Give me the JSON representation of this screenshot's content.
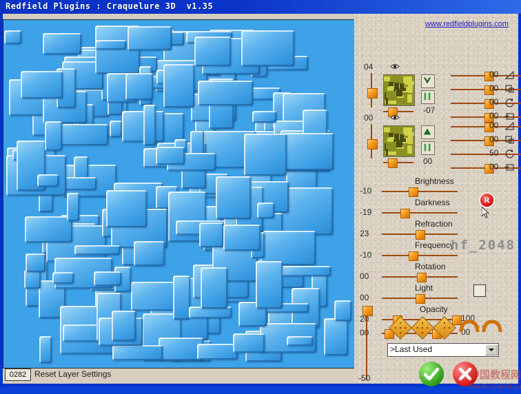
{
  "window": {
    "title": "Redfield Plugins : Craquelure 3D  v1.35"
  },
  "panel": {
    "url": "www.redfieldplugins.com",
    "watermark": "hf_2048",
    "registered_badge": "R",
    "watermark_cn": "中国教程网",
    "watermark_cn_url": "www.jcwcn.com"
  },
  "layers": [
    {
      "name": "layer-1",
      "vertical_value": "04",
      "eye_icon": "eye-icon",
      "thumbnail": "layer-thumbnail",
      "shape_icon": "valley-shape-icon",
      "bars_icon": "bars-shape-icon",
      "offset_value": "-07",
      "sliders": [
        {
          "value": "00",
          "icon": "bevel-wedge-icon",
          "thumb_pct": 50
        },
        {
          "value": "00",
          "icon": "offset-square-icon",
          "thumb_pct": 50
        },
        {
          "value": "00",
          "icon": "rotate-icon",
          "thumb_pct": 50
        },
        {
          "value": "00",
          "icon": "shift-shape-icon",
          "thumb_pct": 50
        }
      ]
    },
    {
      "name": "layer-2",
      "vertical_value": "00",
      "eye_icon": "eye-icon",
      "thumbnail": "layer-thumbnail",
      "shape_icon": "peak-shape-icon",
      "bars_icon": "bars-shape-icon",
      "offset_value": "00",
      "sliders": [
        {
          "value": "00",
          "icon": "bevel-wedge-icon",
          "thumb_pct": 50
        },
        {
          "value": "00",
          "icon": "offset-square-icon",
          "thumb_pct": 50
        },
        {
          "value": "50",
          "icon": "rotate-icon",
          "thumb_pct": 98
        },
        {
          "value": "00",
          "icon": "shift-shape-icon",
          "thumb_pct": 50
        }
      ]
    }
  ],
  "main_sliders": [
    {
      "label": "Brightness",
      "value": "-10",
      "thumb_pct": 41
    },
    {
      "label": "Darkness",
      "value": "-19",
      "thumb_pct": 30
    },
    {
      "label": "Refraction",
      "value": "23",
      "thumb_pct": 50
    },
    {
      "label": "Frequency",
      "value": "-10",
      "thumb_pct": 41
    },
    {
      "label": "Rotation",
      "value": "00",
      "thumb_pct": 52
    },
    {
      "label": "Light",
      "value": "00",
      "thumb_pct": 50
    }
  ],
  "opacity": {
    "label": "Opacity",
    "min_value": "20",
    "max_value": "100",
    "min_pct": 20,
    "max_pct": 98,
    "checkbox_checked": false
  },
  "extra_row": {
    "left_value": "00",
    "right_value": "00",
    "left_pct": 20,
    "right_pct": 64
  },
  "vertical_master": {
    "top_value": "00",
    "bottom_value": "-50"
  },
  "preset_icons": [
    {
      "name": "preset-diamond-1",
      "dots": 5
    },
    {
      "name": "preset-diamond-2",
      "dots": 5
    },
    {
      "name": "preset-diamond-3",
      "dots": 3
    },
    {
      "name": "undo-arc-icon"
    },
    {
      "name": "redo-arc-icon"
    }
  ],
  "preset_dropdown": {
    "value": ">Last Used"
  },
  "buttons": {
    "ok": "ok-button",
    "cancel": "cancel-button"
  },
  "statusbar": {
    "code": "0282",
    "message": "Reset Layer Settings"
  }
}
